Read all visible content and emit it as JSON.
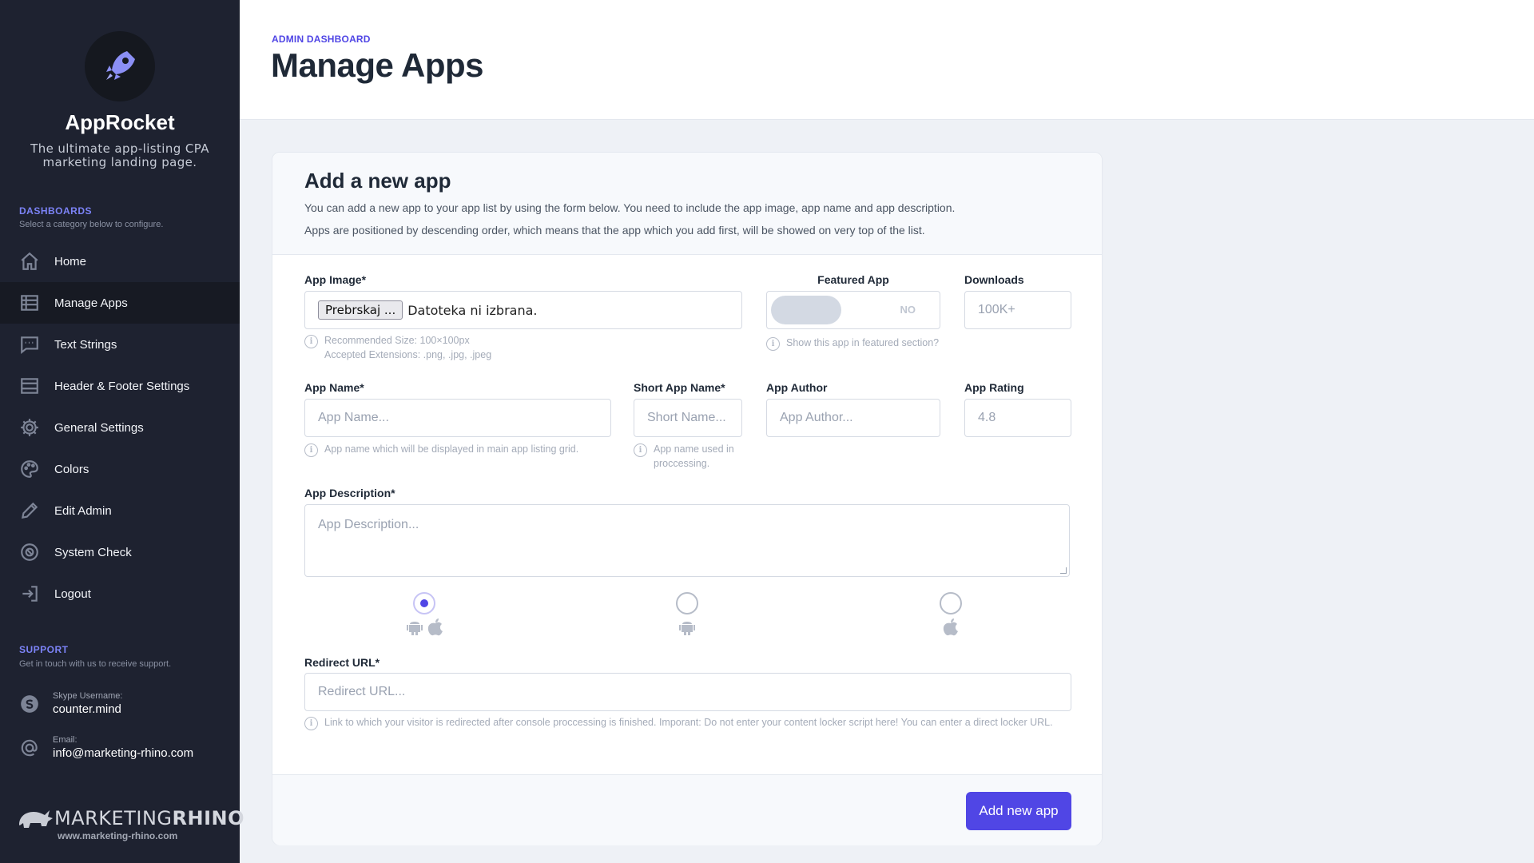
{
  "sidebar": {
    "app_title": "AppRocket",
    "tagline": "The ultimate app-listing CPA marketing landing page.",
    "dashboards_heading": "DASHBOARDS",
    "dashboards_sub": "Select a category below to configure.",
    "items": [
      {
        "label": "Home",
        "icon": "home-icon"
      },
      {
        "label": "Manage Apps",
        "icon": "list-icon",
        "active": true
      },
      {
        "label": "Text Strings",
        "icon": "message-icon"
      },
      {
        "label": "Header & Footer Settings",
        "icon": "layout-icon"
      },
      {
        "label": "General Settings",
        "icon": "gear-icon"
      },
      {
        "label": "Colors",
        "icon": "palette-icon"
      },
      {
        "label": "Edit Admin",
        "icon": "pencil-icon"
      },
      {
        "label": "System Check",
        "icon": "check-icon"
      },
      {
        "label": "Logout",
        "icon": "logout-icon"
      }
    ],
    "support_heading": "SUPPORT",
    "support_sub": "Get in touch with us to receive support.",
    "skype_label": "Skype Username:",
    "skype_value": "counter.mind",
    "email_label": "Email:",
    "email_value": "info@marketing-rhino.com",
    "brand_name": "MARKETING",
    "brand_name_bold": "RHINO",
    "brand_url": "www.marketing-rhino.com"
  },
  "header": {
    "breadcrumb": "ADMIN DASHBOARD",
    "title": "Manage Apps"
  },
  "form": {
    "title": "Add a new app",
    "desc1": "You can add a new app to your app list by using the form below. You need to include the app image, app name and app description.",
    "desc2": "Apps are positioned by descending order, which means that the app which you add first, will be showed on very top of the list.",
    "app_image_label": "App Image*",
    "file_button": "Prebrskaj ...",
    "file_status": "Datoteka ni izbrana.",
    "app_image_hint1": "Recommended Size: 100×100px",
    "app_image_hint2": "Accepted Extensions: .png, .jpg, .jpeg",
    "featured_label": "Featured App",
    "featured_value": "NO",
    "featured_hint": "Show this app in featured section?",
    "downloads_label": "Downloads",
    "downloads_placeholder": "100K+",
    "app_name_label": "App Name*",
    "app_name_placeholder": "App Name...",
    "app_name_hint": "App name which will be displayed in main app listing grid.",
    "short_name_label": "Short App Name*",
    "short_name_placeholder": "Short Name...",
    "short_name_hint": "App name used in proccessing.",
    "author_label": "App Author",
    "author_placeholder": "App Author...",
    "rating_label": "App Rating",
    "rating_placeholder": "4.8",
    "description_label": "App Description*",
    "description_placeholder": "App Description...",
    "platforms": [
      {
        "name": "android-and-ios",
        "selected": true
      },
      {
        "name": "android",
        "selected": false
      },
      {
        "name": "ios",
        "selected": false
      }
    ],
    "redirect_label": "Redirect URL*",
    "redirect_placeholder": "Redirect URL...",
    "redirect_hint": "Link to which your visitor is redirected after console proccessing is finished. Imporant: Do not enter your content locker script here! You can enter a direct locker URL.",
    "submit_label": "Add new app"
  },
  "colors": {
    "accent": "#5046e5",
    "sidebar_bg": "#1e2230",
    "logo_icon": "#8b8ff5"
  }
}
